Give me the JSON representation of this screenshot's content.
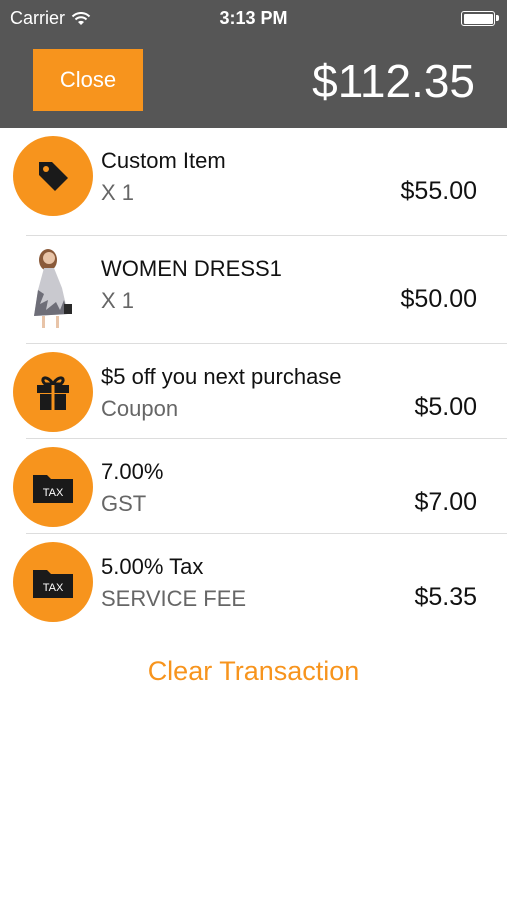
{
  "status_bar": {
    "carrier": "Carrier",
    "time": "3:13 PM"
  },
  "header": {
    "close_label": "Close",
    "total": "$112.35"
  },
  "items": [
    {
      "title": "Custom Item",
      "subtitle": "X  1",
      "price": "$55.00",
      "icon": "price-tag-icon"
    },
    {
      "title": "WOMEN DRESS1",
      "subtitle": "X  1",
      "price": "$50.00",
      "icon": "product-photo"
    },
    {
      "title": "$5 off you next purchase",
      "subtitle": "Coupon",
      "price": "$5.00",
      "icon": "gift-icon"
    },
    {
      "title": "7.00%",
      "subtitle": "GST",
      "price": "$7.00",
      "icon": "tax-folder-icon",
      "icon_text": "TAX"
    },
    {
      "title": "5.00% Tax",
      "subtitle": "SERVICE FEE",
      "price": "$5.35",
      "icon": "tax-folder-icon",
      "icon_text": "TAX"
    }
  ],
  "clear_label": "Clear Transaction",
  "colors": {
    "accent": "#f7941d",
    "header_bg": "#565656"
  }
}
